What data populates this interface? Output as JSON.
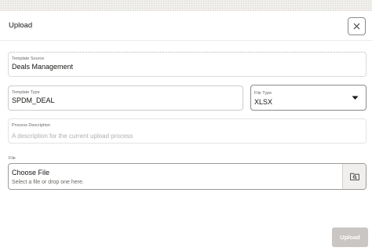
{
  "dialog": {
    "title": "Upload",
    "close_icon": "close-icon"
  },
  "form": {
    "template_source": {
      "label": "Template Source",
      "value": "Deals Management"
    },
    "template_type": {
      "label": "Template Type",
      "value": "SPDM_DEAL"
    },
    "file_type": {
      "label": "File Type",
      "value": "XLSX",
      "icon": "chevron-down-icon"
    },
    "process_description": {
      "label": "Process Description",
      "placeholder": "A description for the current upload process"
    },
    "file": {
      "label": "File",
      "choose_label": "Choose File",
      "hint": "Select a file or drop one here.",
      "icon": "folder-search-icon"
    }
  },
  "actions": {
    "upload_label": "Upload"
  },
  "colors": {
    "text": "#161513",
    "muted": "#6b6864",
    "disabled_button": "#c9c6c3"
  }
}
